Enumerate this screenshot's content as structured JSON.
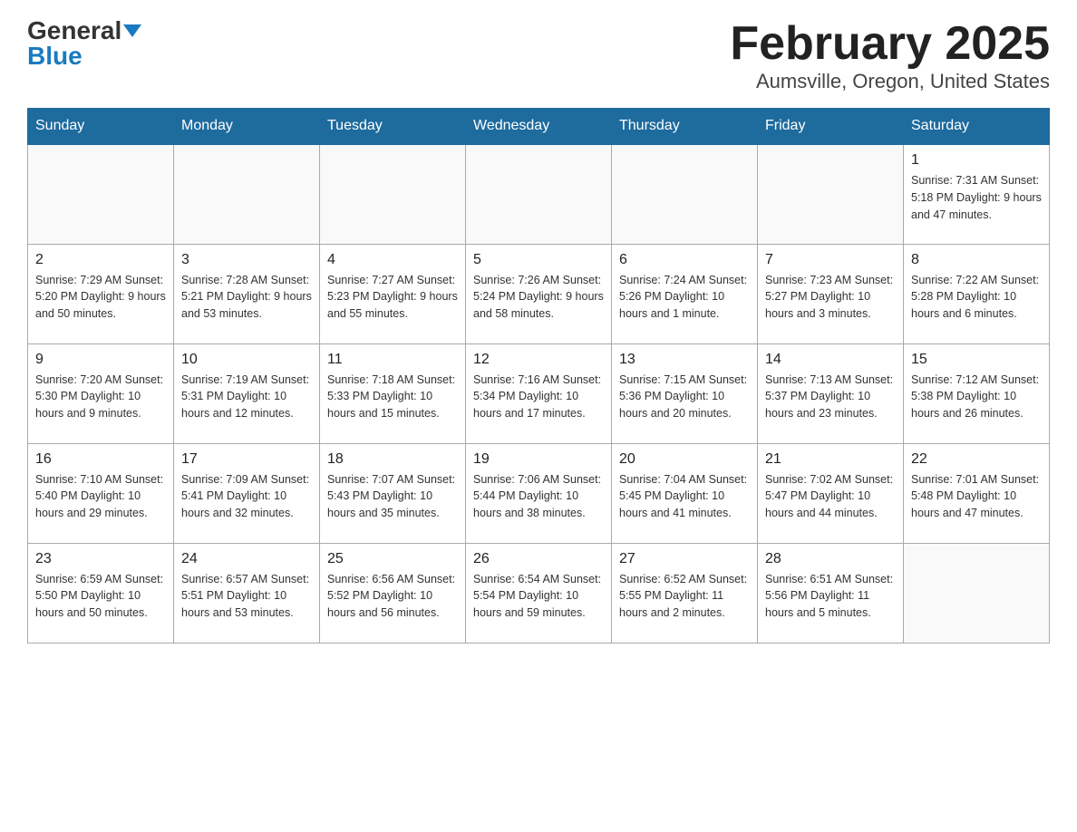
{
  "header": {
    "logo_general": "General",
    "logo_blue": "Blue",
    "title": "February 2025",
    "subtitle": "Aumsville, Oregon, United States"
  },
  "weekdays": [
    "Sunday",
    "Monday",
    "Tuesday",
    "Wednesday",
    "Thursday",
    "Friday",
    "Saturday"
  ],
  "weeks": [
    [
      {
        "day": "",
        "info": ""
      },
      {
        "day": "",
        "info": ""
      },
      {
        "day": "",
        "info": ""
      },
      {
        "day": "",
        "info": ""
      },
      {
        "day": "",
        "info": ""
      },
      {
        "day": "",
        "info": ""
      },
      {
        "day": "1",
        "info": "Sunrise: 7:31 AM\nSunset: 5:18 PM\nDaylight: 9 hours and 47 minutes."
      }
    ],
    [
      {
        "day": "2",
        "info": "Sunrise: 7:29 AM\nSunset: 5:20 PM\nDaylight: 9 hours and 50 minutes."
      },
      {
        "day": "3",
        "info": "Sunrise: 7:28 AM\nSunset: 5:21 PM\nDaylight: 9 hours and 53 minutes."
      },
      {
        "day": "4",
        "info": "Sunrise: 7:27 AM\nSunset: 5:23 PM\nDaylight: 9 hours and 55 minutes."
      },
      {
        "day": "5",
        "info": "Sunrise: 7:26 AM\nSunset: 5:24 PM\nDaylight: 9 hours and 58 minutes."
      },
      {
        "day": "6",
        "info": "Sunrise: 7:24 AM\nSunset: 5:26 PM\nDaylight: 10 hours and 1 minute."
      },
      {
        "day": "7",
        "info": "Sunrise: 7:23 AM\nSunset: 5:27 PM\nDaylight: 10 hours and 3 minutes."
      },
      {
        "day": "8",
        "info": "Sunrise: 7:22 AM\nSunset: 5:28 PM\nDaylight: 10 hours and 6 minutes."
      }
    ],
    [
      {
        "day": "9",
        "info": "Sunrise: 7:20 AM\nSunset: 5:30 PM\nDaylight: 10 hours and 9 minutes."
      },
      {
        "day": "10",
        "info": "Sunrise: 7:19 AM\nSunset: 5:31 PM\nDaylight: 10 hours and 12 minutes."
      },
      {
        "day": "11",
        "info": "Sunrise: 7:18 AM\nSunset: 5:33 PM\nDaylight: 10 hours and 15 minutes."
      },
      {
        "day": "12",
        "info": "Sunrise: 7:16 AM\nSunset: 5:34 PM\nDaylight: 10 hours and 17 minutes."
      },
      {
        "day": "13",
        "info": "Sunrise: 7:15 AM\nSunset: 5:36 PM\nDaylight: 10 hours and 20 minutes."
      },
      {
        "day": "14",
        "info": "Sunrise: 7:13 AM\nSunset: 5:37 PM\nDaylight: 10 hours and 23 minutes."
      },
      {
        "day": "15",
        "info": "Sunrise: 7:12 AM\nSunset: 5:38 PM\nDaylight: 10 hours and 26 minutes."
      }
    ],
    [
      {
        "day": "16",
        "info": "Sunrise: 7:10 AM\nSunset: 5:40 PM\nDaylight: 10 hours and 29 minutes."
      },
      {
        "day": "17",
        "info": "Sunrise: 7:09 AM\nSunset: 5:41 PM\nDaylight: 10 hours and 32 minutes."
      },
      {
        "day": "18",
        "info": "Sunrise: 7:07 AM\nSunset: 5:43 PM\nDaylight: 10 hours and 35 minutes."
      },
      {
        "day": "19",
        "info": "Sunrise: 7:06 AM\nSunset: 5:44 PM\nDaylight: 10 hours and 38 minutes."
      },
      {
        "day": "20",
        "info": "Sunrise: 7:04 AM\nSunset: 5:45 PM\nDaylight: 10 hours and 41 minutes."
      },
      {
        "day": "21",
        "info": "Sunrise: 7:02 AM\nSunset: 5:47 PM\nDaylight: 10 hours and 44 minutes."
      },
      {
        "day": "22",
        "info": "Sunrise: 7:01 AM\nSunset: 5:48 PM\nDaylight: 10 hours and 47 minutes."
      }
    ],
    [
      {
        "day": "23",
        "info": "Sunrise: 6:59 AM\nSunset: 5:50 PM\nDaylight: 10 hours and 50 minutes."
      },
      {
        "day": "24",
        "info": "Sunrise: 6:57 AM\nSunset: 5:51 PM\nDaylight: 10 hours and 53 minutes."
      },
      {
        "day": "25",
        "info": "Sunrise: 6:56 AM\nSunset: 5:52 PM\nDaylight: 10 hours and 56 minutes."
      },
      {
        "day": "26",
        "info": "Sunrise: 6:54 AM\nSunset: 5:54 PM\nDaylight: 10 hours and 59 minutes."
      },
      {
        "day": "27",
        "info": "Sunrise: 6:52 AM\nSunset: 5:55 PM\nDaylight: 11 hours and 2 minutes."
      },
      {
        "day": "28",
        "info": "Sunrise: 6:51 AM\nSunset: 5:56 PM\nDaylight: 11 hours and 5 minutes."
      },
      {
        "day": "",
        "info": ""
      }
    ]
  ]
}
